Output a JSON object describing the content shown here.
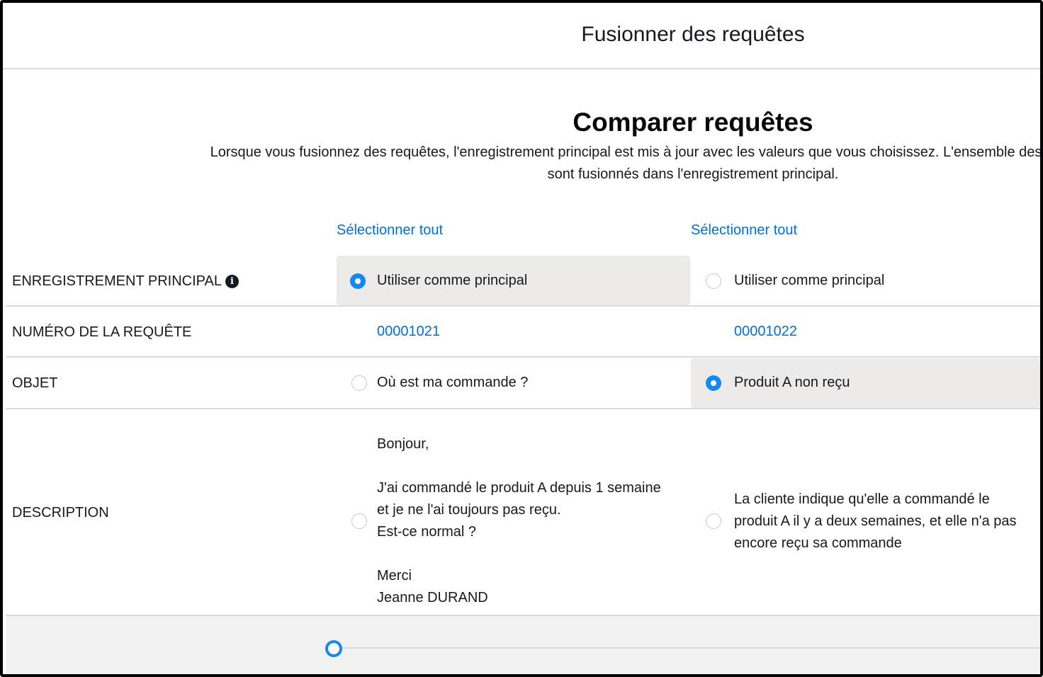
{
  "modal": {
    "title": "Fusionner des requêtes",
    "heading": "Comparer requêtes",
    "description_line1": "Lorsque vous fusionnez des requêtes, l'enregistrement principal est mis à jour avec les valeurs que vous choisissez. L'ensemble des listes associées, des",
    "description_line2": "sont fusionnés dans l'enregistrement principal."
  },
  "columns": [
    {
      "select_all": "Sélectionner tout"
    },
    {
      "select_all": "Sélectionner tout"
    }
  ],
  "rows": {
    "master": {
      "label": "ENREGISTREMENT PRINCIPAL",
      "info_icon": "info-icon",
      "values": [
        "Utiliser comme principal",
        "Utiliser comme principal"
      ],
      "selected": 0
    },
    "case_number": {
      "label": "NUMÉRO DE LA REQUÊTE",
      "values": [
        "00001021",
        "00001022"
      ]
    },
    "subject": {
      "label": "OBJET",
      "values": [
        "Où est ma commande ?",
        "Produit A non reçu"
      ],
      "selected": 1
    },
    "description": {
      "label": "DESCRIPTION",
      "values": [
        {
          "lines": [
            "Bonjour,",
            "",
            "J'ai commandé le produit A depuis 1 semaine",
            "et je ne l'ai toujours pas reçu.",
            "Est-ce normal ?",
            "",
            "Merci",
            "Jeanne DURAND"
          ]
        },
        {
          "lines": [
            "La cliente indique qu'elle a commandé le",
            "produit A il y a deux semaines, et elle n'a pas",
            "encore reçu sa commande"
          ]
        }
      ],
      "selected": null
    }
  },
  "footer": {
    "progress_step": 1
  },
  "colors": {
    "link": "#0070d2",
    "radio_checked": "#1589ee",
    "selected_cell": "#ecebea",
    "divider": "#dddbda",
    "footer_bg": "#f3f2f2"
  }
}
